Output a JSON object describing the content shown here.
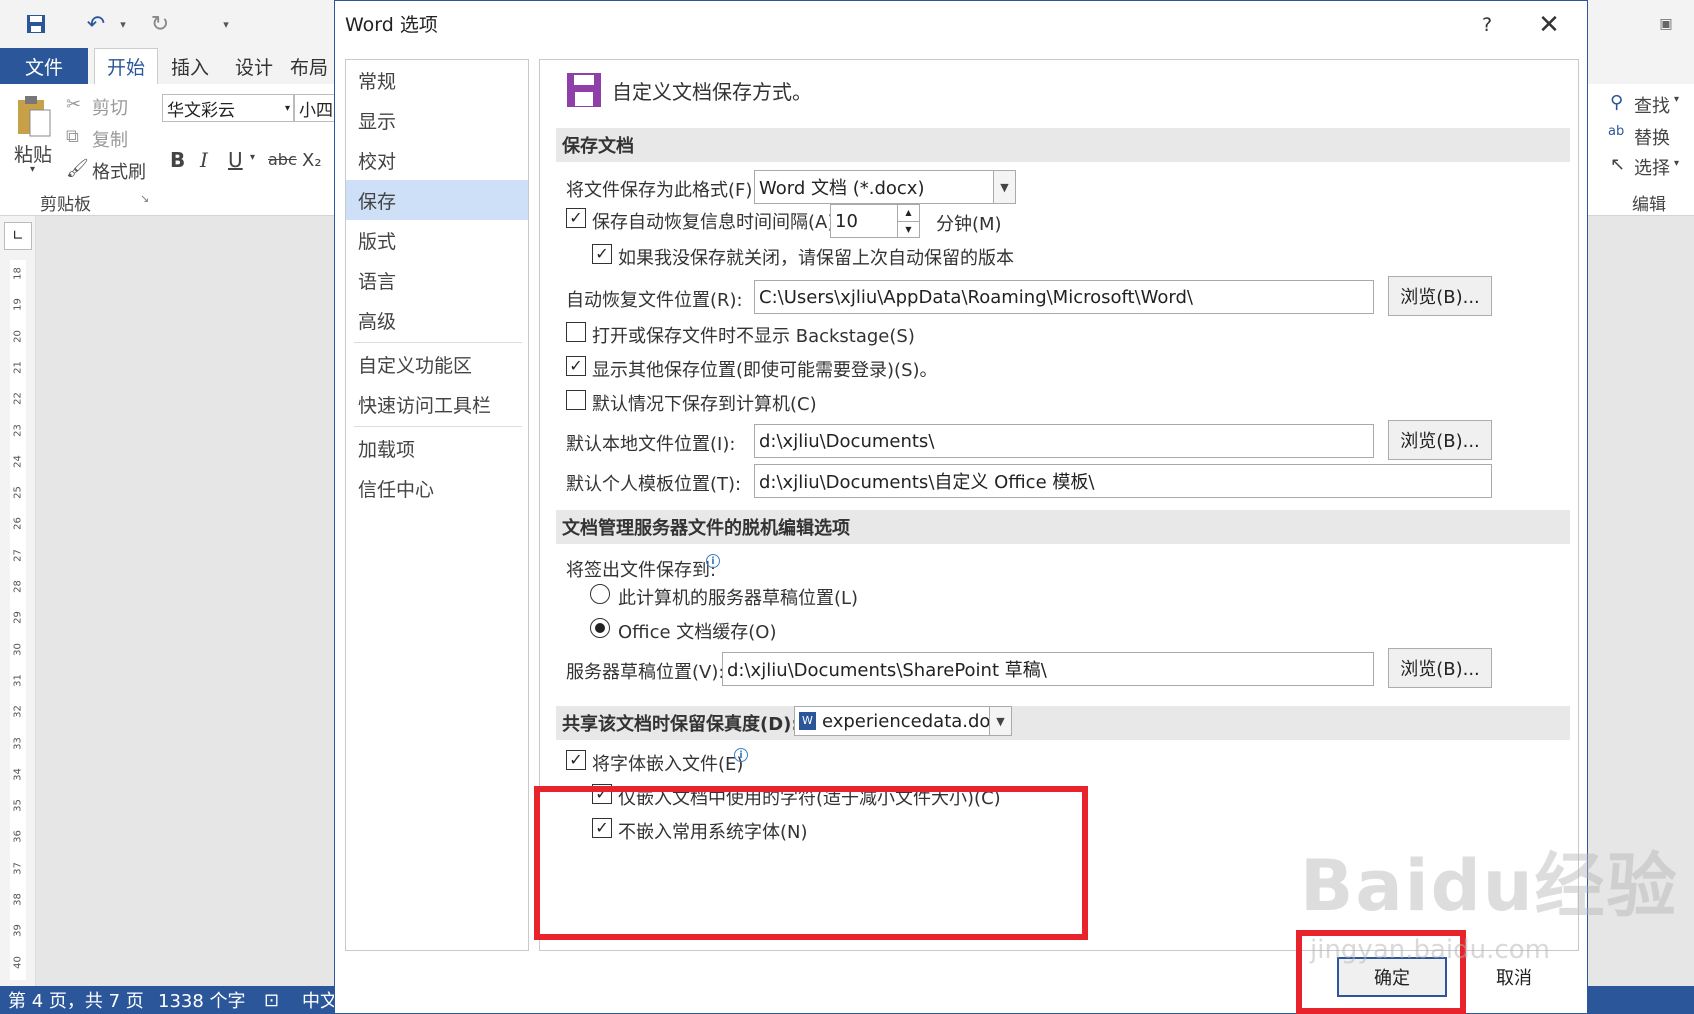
{
  "word": {
    "tabs": [
      "文件",
      "开始",
      "插入",
      "设计",
      "布局"
    ],
    "clipboard": {
      "paste": "粘贴",
      "cut": "剪切",
      "copy": "复制",
      "format_painter": "格式刷",
      "group_label": "剪贴板"
    },
    "font_name": "华文彩云",
    "font_size": "小四",
    "format_buttons": [
      "B",
      "I",
      "U",
      "abc",
      "X₂"
    ],
    "editing": {
      "find": "查找",
      "replace": "替换",
      "select": "选择",
      "group_label": "编辑"
    },
    "ruler_numbers": [
      "18",
      "19",
      "20",
      "21",
      "22",
      "23",
      "24",
      "25",
      "26",
      "27",
      "28",
      "29",
      "30",
      "31",
      "32",
      "33",
      "34",
      "35",
      "36",
      "37",
      "38",
      "39",
      "40"
    ],
    "status": {
      "page": "第 4 页，共 7 页",
      "words": "1338 个字",
      "lang": "中文"
    }
  },
  "dialog": {
    "title": "Word 选项",
    "help": "?",
    "close": "✕",
    "nav": [
      "常规",
      "显示",
      "校对",
      "保存",
      "版式",
      "语言",
      "高级",
      "自定义功能区",
      "快速访问工具栏",
      "加载项",
      "信任中心"
    ],
    "nav_selected": 3,
    "header_text": "自定义文档保存方式。",
    "save_section": {
      "title": "保存文档",
      "format_label": "将文件保存为此格式(F):",
      "format_value": "Word 文档 (*.docx)",
      "autorecover_label": "保存自动恢复信息时间间隔(A)",
      "autorecover_value": "10",
      "minutes_label": "分钟(M)",
      "keep_last_label": "如果我没保存就关闭，请保留上次自动保留的版本",
      "autorecover_loc_label": "自动恢复文件位置(R):",
      "autorecover_loc_value": "C:\\Users\\xjliu\\AppData\\Roaming\\Microsoft\\Word\\",
      "browse": "浏览(B)...",
      "no_backstage_label": "打开或保存文件时不显示 Backstage(S)",
      "show_other_label": "显示其他保存位置(即使可能需要登录)(S)。",
      "default_pc_label": "默认情况下保存到计算机(C)",
      "local_loc_label": "默认本地文件位置(I):",
      "local_loc_value": "d:\\xjliu\\Documents\\",
      "template_loc_label": "默认个人模板位置(T):",
      "template_loc_value": "d:\\xjliu\\Documents\\自定义 Office 模板\\"
    },
    "offline_section": {
      "title": "文档管理服务器文件的脱机编辑选项",
      "checkout_label": "将签出文件保存到:",
      "server_drafts_label": "此计算机的服务器草稿位置(L)",
      "office_cache_label": "Office 文档缓存(O)",
      "drafts_loc_label": "服务器草稿位置(V):",
      "drafts_loc_value": "d:\\xjliu\\Documents\\SharePoint 草稿\\"
    },
    "fidelity_section": {
      "title": "共享该文档时保留保真度(D):",
      "doc_value": "experiencedata.docx",
      "embed_fonts_label": "将字体嵌入文件(E)",
      "embed_used_label": "仅嵌入文档中使用的字符(适于减小文件大小)(C)",
      "no_common_label": "不嵌入常用系统字体(N)"
    },
    "ok": "确定",
    "cancel": "取消",
    "checkmark": "✓"
  },
  "watermark": {
    "main": "Baidu经验",
    "sub": "jingyan.baidu.com"
  },
  "colors": {
    "accent": "#2b579a",
    "highlight_red": "#e8232b",
    "nav_selected": "#cde0f7"
  }
}
